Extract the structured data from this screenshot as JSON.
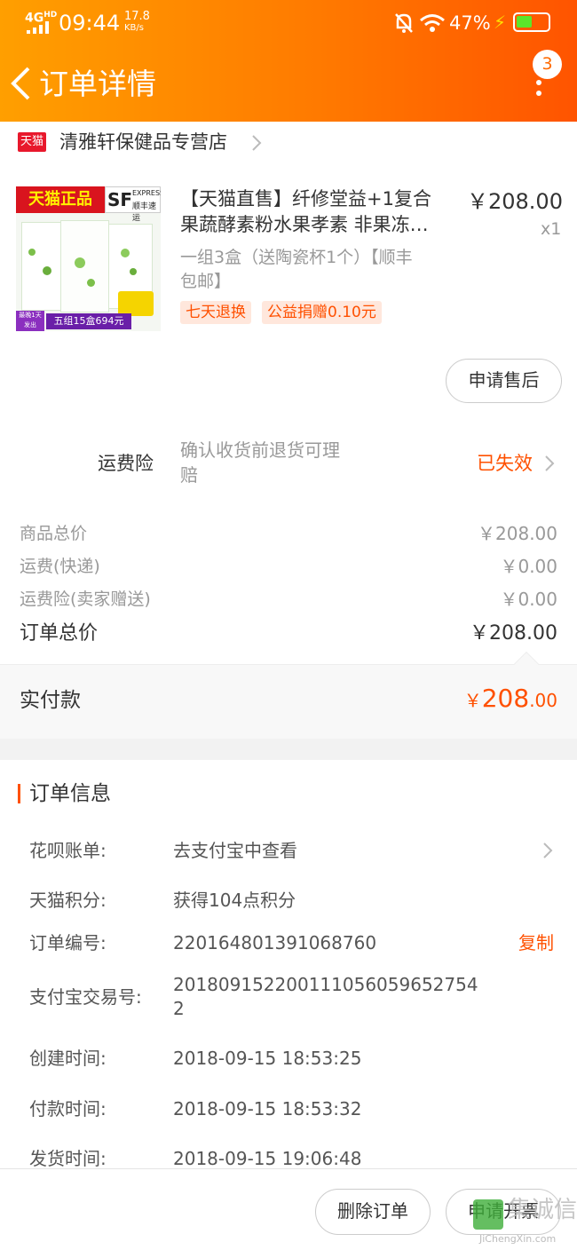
{
  "status_bar": {
    "network": "4G",
    "network_sup": "HD",
    "time": "09:44",
    "speed_value": "17.8",
    "speed_unit": "KB/s",
    "battery": "47%"
  },
  "header": {
    "title": "订单详情",
    "badge": "3"
  },
  "shop": {
    "tag": "天猫",
    "name": "清雅轩保健品专营店"
  },
  "product": {
    "image_banner": "天猫正品",
    "image_sf": "SF",
    "image_sf_sub": "EXPRESS",
    "image_sf_cn": "顺丰速运",
    "image_promo": "五组15盒694元",
    "image_tag": "最晚1天发出",
    "title_line1": "【天猫直售】纤修堂益+1复合",
    "title_line2": "果蔬酵素粉水果孝素 非果冻…",
    "price": "￥208.00",
    "qty": "x1",
    "spec_line1": "一组3盒（送陶瓷杯1个）【顺丰",
    "spec_line2": "包邮】",
    "tag1": "七天退换",
    "tag2": "公益捐赠0.10元"
  },
  "after_sale_label": "申请售后",
  "insurance": {
    "label": "运费险",
    "desc_line1": "确认收货前退货可理",
    "desc_line2": "赔",
    "status": "已失效"
  },
  "summary": {
    "rows": [
      {
        "label": "商品总价",
        "value": "￥208.00"
      },
      {
        "label": "运费(快递)",
        "value": "￥0.00"
      },
      {
        "label": "运费险(卖家赠送)",
        "value": "￥0.00"
      }
    ],
    "total_label": "订单总价",
    "total_value": "￥208.00"
  },
  "paid": {
    "label": "实付款",
    "currency": "￥",
    "amount": "208",
    "cents": ".00"
  },
  "order_info": {
    "title": "订单信息",
    "huabei_label": "花呗账单:",
    "huabei_value": "去支付宝中查看",
    "points_label": "天猫积分:",
    "points_value": "获得104点积分",
    "order_no_label": "订单编号:",
    "order_no_value": "220164801391068760",
    "copy_label": "复制",
    "alipay_label": "支付宝交易号:",
    "alipay_value_line1": "201809152200111056059652754",
    "alipay_value_line2": "2",
    "created_label": "创建时间:",
    "created_value": "2018-09-15 18:53:25",
    "paid_label": "付款时间:",
    "paid_value": "2018-09-15 18:53:32",
    "shipped_label": "发货时间:",
    "shipped_value": "2018-09-15 19:06:48"
  },
  "footer": {
    "delete_label": "删除订单",
    "invoice_label": "申请开票"
  },
  "watermark": {
    "text": "集诚信",
    "url": "JiChengXin.com"
  },
  "colors": {
    "accent": "#ff5000",
    "header_start": "#ff9f00",
    "header_end": "#ff5400"
  }
}
